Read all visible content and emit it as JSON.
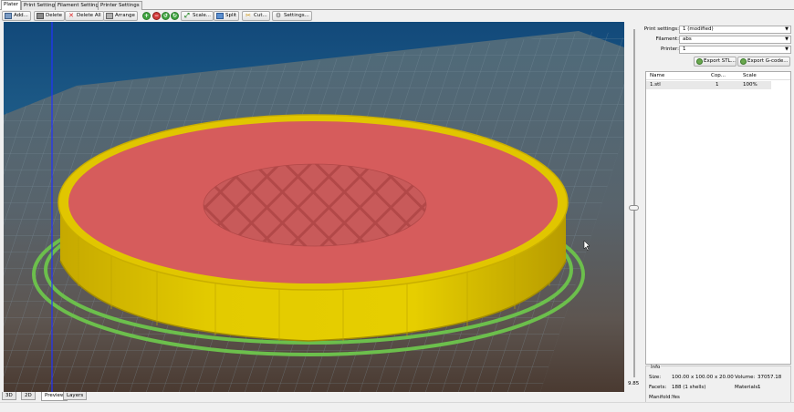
{
  "tabs": [
    "Plater",
    "Print Settings",
    "Filament Settings",
    "Printer Settings"
  ],
  "toolbar": {
    "add": "Add...",
    "delete": "Delete",
    "delete_all": "Delete All",
    "arrange": "Arrange",
    "scale": "Scale...",
    "split": "Split",
    "cut": "Cut...",
    "settings": "Settings..."
  },
  "settings": {
    "print_label": "Print settings:",
    "print_value": "1 (modified)",
    "filament_label": "Filament:",
    "filament_value": "abs",
    "printer_label": "Printer:",
    "printer_value": "1"
  },
  "export": {
    "stl": "Export STL...",
    "gcode": "Export G-code..."
  },
  "object_list": {
    "columns": [
      "Name",
      "Cop...",
      "Scale"
    ],
    "rows": [
      {
        "name": "1.stl",
        "copies": "1",
        "scale": "100%"
      }
    ]
  },
  "info": {
    "legend": "Info",
    "size_label": "Size:",
    "size_value": "100.00 x 100.00 x 20.00",
    "volume_label": "Volume:",
    "volume_value": "37057.18",
    "facets_label": "Facets:",
    "facets_value": "188 (1 shells)",
    "materials_label": "Materials:",
    "materials_value": "1",
    "manifold_label": "Manifold:",
    "manifold_value": "Yes"
  },
  "slider_value": "9.85",
  "view_tabs": [
    "3D",
    "2D",
    "Preview",
    "Layers"
  ],
  "active_view_tab": "Preview",
  "colors": {
    "bed_grid": "#5e7e90",
    "top_fill": "#d65c5c",
    "perimeter": "#d9c100",
    "skirt": "#6cbf4c",
    "background_top": "#17507a"
  }
}
